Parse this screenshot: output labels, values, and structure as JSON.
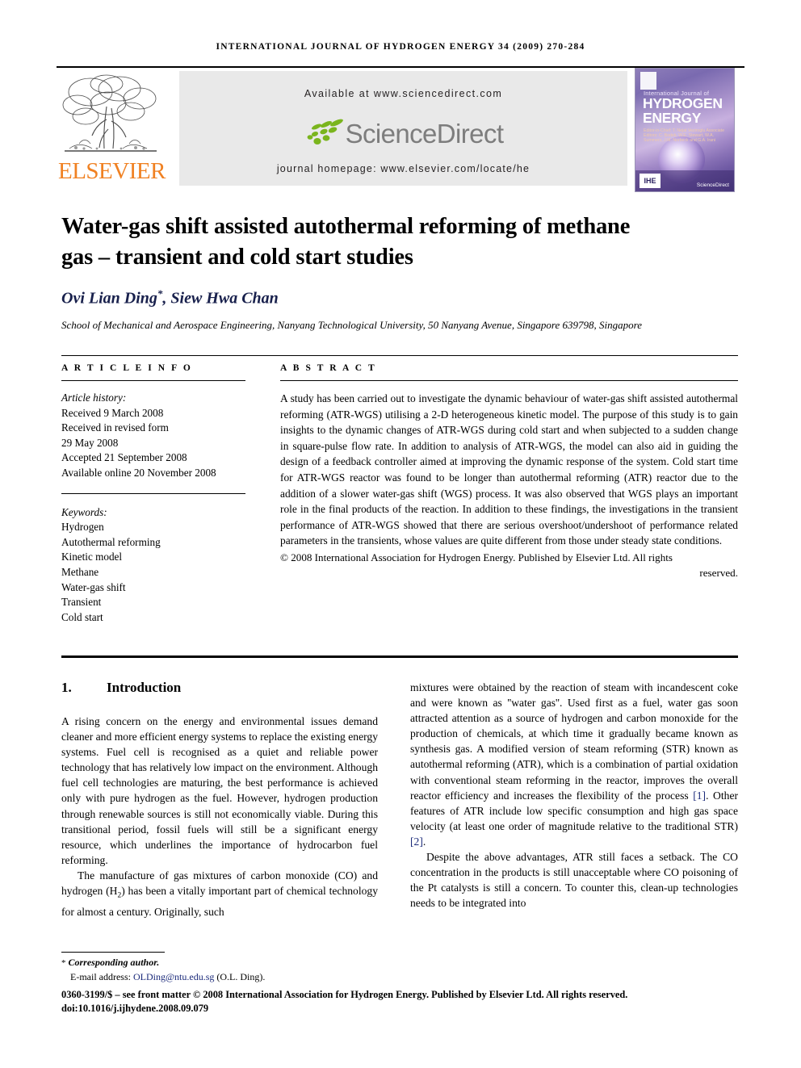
{
  "running_head": "INTERNATIONAL JOURNAL OF HYDROGEN ENERGY 34 (2009) 270-284",
  "masthead": {
    "publisher_name": "ELSEVIER",
    "publisher_color": "#F08122",
    "available_at": "Available at www.sciencedirect.com",
    "sciencedirect_wordmark": "ScienceDirect",
    "journal_homepage": "journal homepage: www.elsevier.com/locate/he",
    "banner_bg": "#e9e9e9",
    "cover": {
      "line_small": "International Journal of",
      "line_big_1": "HYDROGEN",
      "line_big_2": "ENERGY",
      "editors": "Editor-in-Chief: T. Nejat Veziroglu    Associate Editors: C. Bodek, W.E. Stewart, W.A. Summers, J.M. Norbeck and G.A. Irani",
      "badge": "IHE",
      "mini_sciencedirect": "ScienceDirect"
    }
  },
  "title": "Water-gas shift assisted autothermal reforming of methane gas – transient and cold start studies",
  "authors": "Ovi Lian Ding",
  "authors_rest": ", Siew Hwa Chan",
  "author_marker": "*",
  "affiliation": "School of Mechanical and Aerospace Engineering, Nanyang Technological University, 50 Nanyang Avenue, Singapore 639798, Singapore",
  "article_info": {
    "heading": "A R T I C L E   I N F O",
    "history_label": "Article history:",
    "history": [
      "Received 9 March 2008",
      "Received in revised form",
      "29 May 2008",
      "Accepted 21 September 2008",
      "Available online 20 November 2008"
    ],
    "keywords_label": "Keywords:",
    "keywords": [
      "Hydrogen",
      "Autothermal reforming",
      "Kinetic model",
      "Methane",
      "Water-gas shift",
      "Transient",
      "Cold start"
    ]
  },
  "abstract": {
    "heading": "A B S T R A C T",
    "text": "A study has been carried out to investigate the dynamic behaviour of water-gas shift assisted autothermal reforming (ATR-WGS) utilising a 2-D heterogeneous kinetic model. The purpose of this study is to gain insights to the dynamic changes of ATR-WGS during cold start and when subjected to a sudden change in square-pulse flow rate. In addition to analysis of ATR-WGS, the model can also aid in guiding the design of a feedback controller aimed at improving the dynamic response of the system. Cold start time for ATR-WGS reactor was found to be longer than autothermal reforming (ATR) reactor due to the addition of a slower water-gas shift (WGS) process. It was also observed that WGS plays an important role in the final products of the reaction. In addition to these findings, the investigations in the transient performance of ATR-WGS showed that there are serious overshoot/undershoot of performance related parameters in the transients, whose values are quite different from those under steady state conditions.",
    "copyright_main": "© 2008 International Association for Hydrogen Energy. Published by Elsevier Ltd. All rights",
    "copyright_tail": "reserved."
  },
  "body": {
    "section_number": "1.",
    "section_title": "Introduction",
    "left_para_1": "A rising concern on the energy and environmental issues demand cleaner and more efficient energy systems to replace the existing energy systems. Fuel cell is recognised as a quiet and reliable power technology that has relatively low impact on the environment. Although fuel cell technologies are maturing, the best performance is achieved only with pure hydrogen as the fuel. However, hydrogen production through renewable sources is still not economically viable. During this transitional period, fossil fuels will still be a significant energy resource, which underlines the importance of hydrocarbon fuel reforming.",
    "left_para_2_a": "The manufacture of gas mixtures of carbon monoxide (CO) and hydrogen (H",
    "left_para_2_sub": "2",
    "left_para_2_b": ") has been a vitally important part of chemical technology for almost a century. Originally, such",
    "right_para_1_a": "mixtures were obtained by the reaction of steam with incandescent coke and were known as ''water gas''. Used first as a fuel, water gas soon attracted attention as a source of hydrogen and carbon monoxide for the production of chemicals, at which time it gradually became known as synthesis gas. A modified version of steam reforming (STR) known as autothermal reforming (ATR), which is a combination of partial oxidation with conventional steam reforming in the reactor, improves the overall reactor efficiency and increases the flexibility of the process ",
    "right_ref_1": "[1]",
    "right_para_1_b": ". Other features of ATR include low specific consumption and high gas space velocity (at least one order of magnitude relative to the traditional STR) ",
    "right_ref_2": "[2]",
    "right_para_1_c": ".",
    "right_para_2": "Despite the above advantages, ATR still faces a setback. The CO concentration in the products is still unacceptable where CO poisoning of the Pt catalysts is still a concern. To counter this, clean-up technologies needs to be integrated into"
  },
  "footnote": {
    "marker": "*",
    "corresponding": "Corresponding author.",
    "email_label": "E-mail address: ",
    "email": "OLDing@ntu.edu.sg",
    "email_owner": " (O.L. Ding).",
    "link_color": "#1b2a7a"
  },
  "issn_line_1": "0360-3199/$ – see front matter © 2008 International Association for Hydrogen Energy. Published by Elsevier Ltd. All rights reserved.",
  "issn_line_2": "doi:10.1016/j.ijhydene.2008.09.079"
}
